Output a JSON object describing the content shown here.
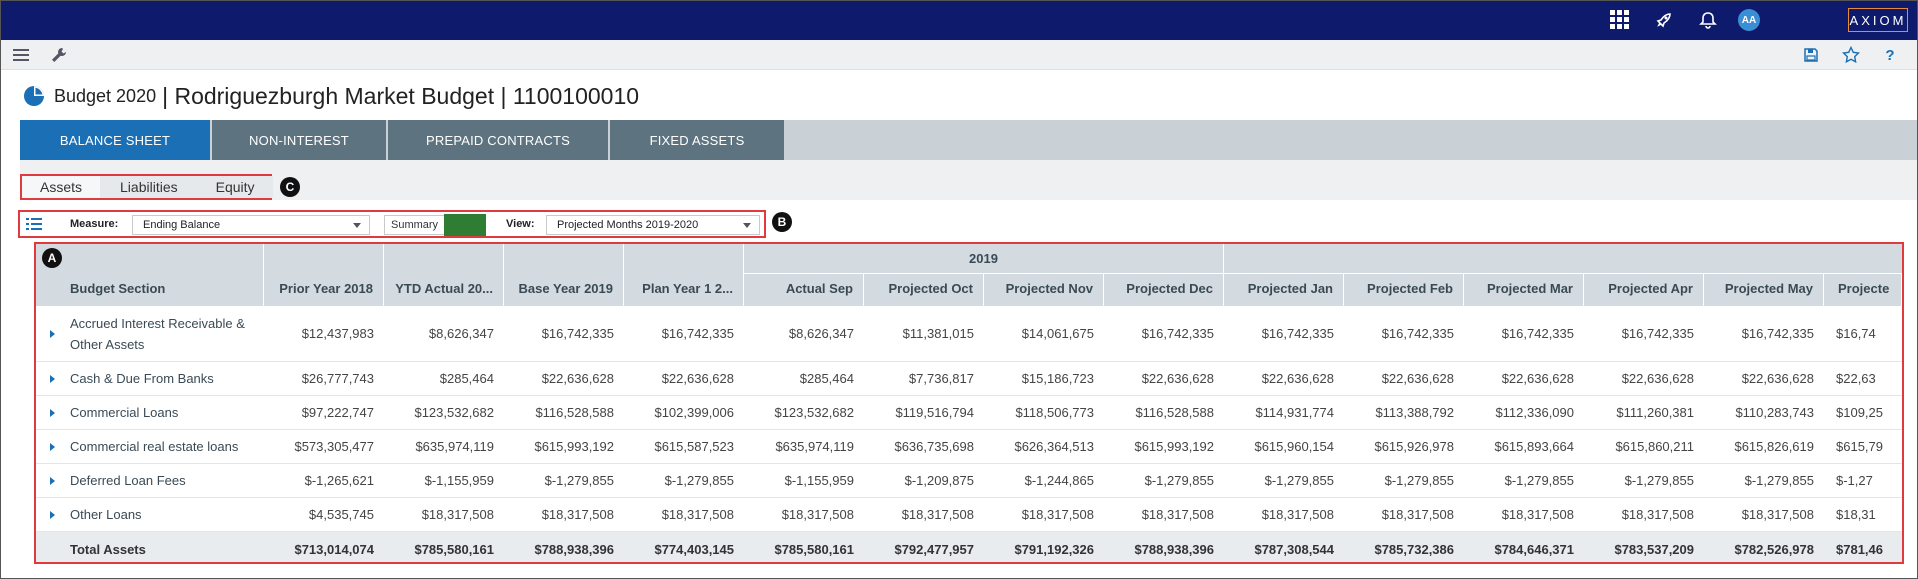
{
  "header": {
    "avatar_initials": "AA",
    "logo_text": "AXIOM",
    "icons": [
      "apps-grid-icon",
      "rocket-icon",
      "bell-icon"
    ]
  },
  "toolbar": {
    "icons_left": [
      "hamburger-menu-icon",
      "wrench-icon"
    ],
    "icons_right": [
      "save-icon",
      "star-icon",
      "help-icon"
    ],
    "help_label": "?"
  },
  "page": {
    "title_prefix": "Budget 2020",
    "title_main": "| Rodriguezburgh Market Budget | 1100100010",
    "accent_color": "#1a6fb5"
  },
  "tabs": [
    {
      "label": "BALANCE SHEET",
      "active": true
    },
    {
      "label": "NON-INTEREST",
      "active": false
    },
    {
      "label": "PREPAID CONTRACTS",
      "active": false
    },
    {
      "label": "FIXED ASSETS",
      "active": false
    }
  ],
  "subtabs": [
    {
      "label": "Assets",
      "active": true
    },
    {
      "label": "Liabilities",
      "active": false
    },
    {
      "label": "Equity",
      "active": false
    }
  ],
  "callouts": {
    "a": "A",
    "b": "B",
    "c": "C"
  },
  "filters": {
    "measure_label": "Measure:",
    "measure_value": "Ending Balance",
    "summary_label": "Summary",
    "summary_toggle_color": "#2e7d32",
    "view_label": "View:",
    "view_value": "Projected Months 2019-2020"
  },
  "table": {
    "year_group": "2019",
    "columns": [
      "Budget Section",
      "Prior Year 2018",
      "YTD Actual 20...",
      "Base Year 2019",
      "Plan Year 1 2...",
      "Actual Sep",
      "Projected Oct",
      "Projected Nov",
      "Projected Dec",
      "Projected Jan",
      "Projected Feb",
      "Projected Mar",
      "Projected Apr",
      "Projected May",
      "Projecte"
    ],
    "rows": [
      {
        "label": "Accrued Interest Receivable & Other Assets",
        "values": [
          "$12,437,983",
          "$8,626,347",
          "$16,742,335",
          "$16,742,335",
          "$8,626,347",
          "$11,381,015",
          "$14,061,675",
          "$16,742,335",
          "$16,742,335",
          "$16,742,335",
          "$16,742,335",
          "$16,742,335",
          "$16,742,335",
          "$16,74"
        ]
      },
      {
        "label": "Cash & Due From Banks",
        "values": [
          "$26,777,743",
          "$285,464",
          "$22,636,628",
          "$22,636,628",
          "$285,464",
          "$7,736,817",
          "$15,186,723",
          "$22,636,628",
          "$22,636,628",
          "$22,636,628",
          "$22,636,628",
          "$22,636,628",
          "$22,636,628",
          "$22,63"
        ]
      },
      {
        "label": "Commercial Loans",
        "values": [
          "$97,222,747",
          "$123,532,682",
          "$116,528,588",
          "$102,399,006",
          "$123,532,682",
          "$119,516,794",
          "$118,506,773",
          "$116,528,588",
          "$114,931,774",
          "$113,388,792",
          "$112,336,090",
          "$111,260,381",
          "$110,283,743",
          "$109,25"
        ]
      },
      {
        "label": "Commercial real estate loans",
        "values": [
          "$573,305,477",
          "$635,974,119",
          "$615,993,192",
          "$615,587,523",
          "$635,974,119",
          "$636,735,698",
          "$626,364,513",
          "$615,993,192",
          "$615,960,154",
          "$615,926,978",
          "$615,893,664",
          "$615,860,211",
          "$615,826,619",
          "$615,79"
        ]
      },
      {
        "label": "Deferred Loan Fees",
        "values": [
          "$-1,265,621",
          "$-1,155,959",
          "$-1,279,855",
          "$-1,279,855",
          "$-1,155,959",
          "$-1,209,875",
          "$-1,244,865",
          "$-1,279,855",
          "$-1,279,855",
          "$-1,279,855",
          "$-1,279,855",
          "$-1,279,855",
          "$-1,279,855",
          "$-1,27"
        ]
      },
      {
        "label": "Other Loans",
        "values": [
          "$4,535,745",
          "$18,317,508",
          "$18,317,508",
          "$18,317,508",
          "$18,317,508",
          "$18,317,508",
          "$18,317,508",
          "$18,317,508",
          "$18,317,508",
          "$18,317,508",
          "$18,317,508",
          "$18,317,508",
          "$18,317,508",
          "$18,31"
        ]
      }
    ],
    "total": {
      "label": "Total Assets",
      "values": [
        "$713,014,074",
        "$785,580,161",
        "$788,938,396",
        "$774,403,145",
        "$785,580,161",
        "$792,477,957",
        "$791,192,326",
        "$788,938,396",
        "$787,308,544",
        "$785,732,386",
        "$784,646,371",
        "$783,537,209",
        "$782,526,978",
        "$781,46"
      ]
    }
  }
}
